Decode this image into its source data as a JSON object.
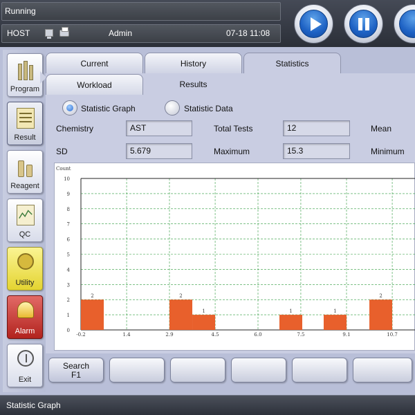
{
  "status": {
    "text": "Running"
  },
  "info": {
    "host": "HOST",
    "user": "Admin",
    "datetime": "07-18 11:08"
  },
  "controls": {
    "buttons": [
      "play",
      "pause",
      "stop"
    ]
  },
  "sidebar": {
    "items": [
      {
        "label": "Program",
        "icon": "program-icon"
      },
      {
        "label": "Result",
        "icon": "result-icon",
        "active": true
      },
      {
        "label": "Reagent",
        "icon": "reagent-icon"
      },
      {
        "label": "QC",
        "icon": "qc-icon"
      },
      {
        "label": "Utility",
        "icon": "utility-icon"
      },
      {
        "label": "Alarm",
        "icon": "alarm-icon"
      },
      {
        "label": "Exit",
        "icon": "exit-icon"
      }
    ]
  },
  "tabs": [
    {
      "label": "Current"
    },
    {
      "label": "History"
    },
    {
      "label": "Statistics",
      "selected": true
    }
  ],
  "subtabs": [
    {
      "label": "Workload"
    },
    {
      "label": "Results",
      "selected": true
    }
  ],
  "view": {
    "options": [
      {
        "label": "Statistic Graph",
        "checked": true
      },
      {
        "label": "Statistic Data",
        "checked": false
      }
    ]
  },
  "fields": {
    "chemistry": {
      "label": "Chemistry",
      "value": "AST"
    },
    "total_tests": {
      "label": "Total Tests",
      "value": "12"
    },
    "mean": {
      "label": "Mean"
    },
    "sd": {
      "label": "SD",
      "value": "5.679"
    },
    "maximum": {
      "label": "Maximum",
      "value": "15.3"
    },
    "minimum": {
      "label": "Minimum"
    }
  },
  "chart_data": {
    "type": "bar",
    "ylabel": "Count",
    "ylim": [
      0,
      10
    ],
    "yticks": [
      "0",
      "1",
      "2",
      "3",
      "4",
      "5",
      "6",
      "7",
      "8",
      "9",
      "10"
    ],
    "x_ticks": [
      "-0.2",
      "1.4",
      "2.9",
      "4.5",
      "6.0",
      "7.5",
      "9.1",
      "10.7"
    ],
    "bins": [
      {
        "x_start": -0.2,
        "value": 2
      },
      {
        "x_start": 2.9,
        "value": 2
      },
      {
        "x_start": 3.7,
        "value": 1
      },
      {
        "x_start": 6.75,
        "value": 1
      },
      {
        "x_start": 8.3,
        "value": 1
      },
      {
        "x_start": 9.9,
        "value": 2
      }
    ],
    "bin_width": 0.8,
    "x_min": -0.2,
    "x_tick_step": 1.55,
    "bar_color": "#e8602c",
    "grid_color": "#2e9a3c",
    "grid": true
  },
  "function_buttons": {
    "search_label": "Search",
    "search_key": "F1",
    "empty": [
      "",
      "",
      "",
      "",
      ""
    ]
  },
  "footer": {
    "text": "Statistic Graph"
  }
}
